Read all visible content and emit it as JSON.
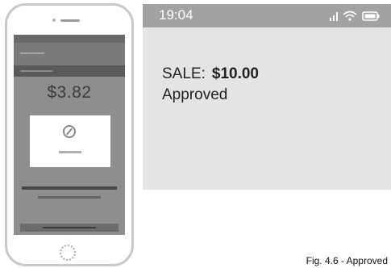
{
  "screen": {
    "status_time": "19:04",
    "sale_label": "SALE:",
    "sale_amount": "$10.00",
    "status_text": "Approved"
  },
  "phone_illustration": {
    "amount": "$3.82"
  },
  "caption": "Fig. 4.6 - Approved",
  "icons": [
    "signal-icon",
    "wifi-icon",
    "battery-icon",
    "spinner-icon"
  ],
  "colors": {
    "status_bar": "#a2a2a2",
    "screen_background": "#e4e4e4",
    "phone_screen": "#8e8e8e"
  }
}
